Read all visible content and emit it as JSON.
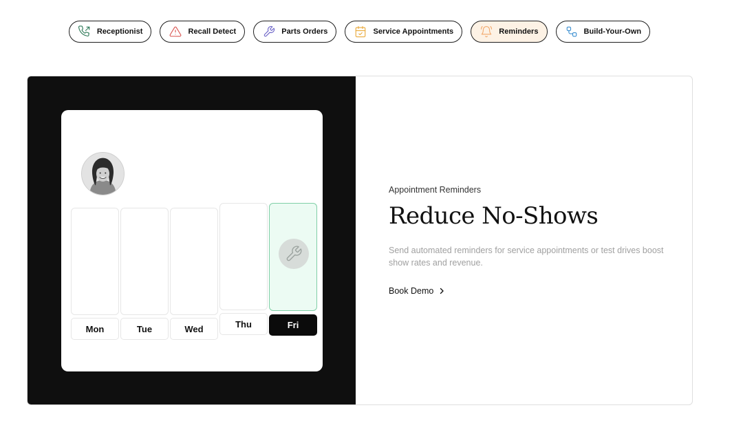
{
  "tabs": [
    {
      "label": "Receptionist",
      "icon": "phone-outgoing-icon",
      "active": false
    },
    {
      "label": "Recall Detect",
      "icon": "warning-triangle-icon",
      "active": false
    },
    {
      "label": "Parts Orders",
      "icon": "wrench-icon",
      "active": false
    },
    {
      "label": "Service Appointments",
      "icon": "calendar-check-icon",
      "active": false
    },
    {
      "label": "Reminders",
      "icon": "bell-icon",
      "active": true
    },
    {
      "label": "Build-Your-Own",
      "icon": "workflow-icon",
      "active": false
    }
  ],
  "colors": {
    "phone": "#2f7a59",
    "warning": "#d9534f",
    "wrench": "#6b63c7",
    "calendar": "#e9a93a",
    "bell": "#f2a86b",
    "workflow": "#3b8fd1",
    "active_pill_bg": "#fdf2e5",
    "highlight_green": "#7fcfa6"
  },
  "calendar": {
    "days": [
      "Mon",
      "Tue",
      "Wed",
      "Thu",
      "Fri"
    ],
    "selected_day": "Fri"
  },
  "content": {
    "eyebrow": "Appointment Reminders",
    "headline": "Reduce No-Shows",
    "description": "Send automated reminders for service appointments or test drives boost show rates and revenue.",
    "cta_label": "Book Demo",
    "cta_icon": "chevron-right-icon"
  }
}
